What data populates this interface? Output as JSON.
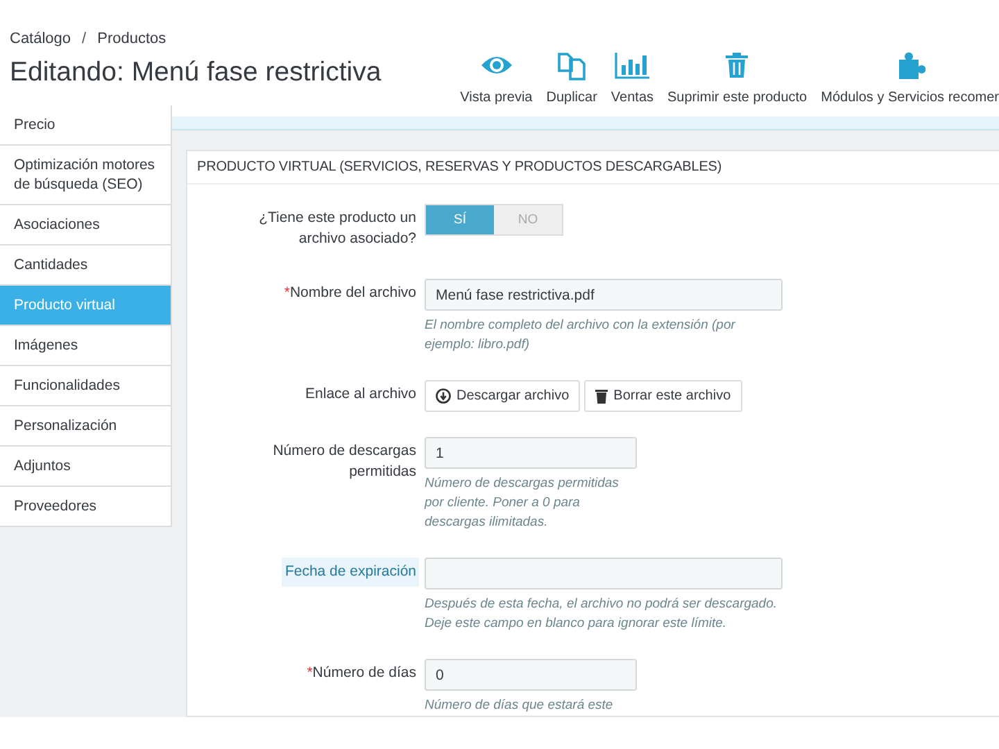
{
  "breadcrumb": {
    "separator": "/",
    "items": [
      "Catálogo",
      "Productos"
    ]
  },
  "title": "Editando: Menú fase restrictiva",
  "toolbar": [
    {
      "label": "Vista previa",
      "kind": "preview"
    },
    {
      "label": "Duplicar",
      "kind": "duplicate"
    },
    {
      "label": "Ventas",
      "kind": "sales"
    },
    {
      "label": "Suprimir este producto",
      "kind": "delete"
    },
    {
      "label": "Módulos y Servicios recomer",
      "kind": "modules"
    }
  ],
  "sidebar": {
    "items": [
      {
        "label": "Precio",
        "selected": false
      },
      {
        "label": "Optimización motores de búsqueda (SEO)",
        "selected": false
      },
      {
        "label": "Asociaciones",
        "selected": false
      },
      {
        "label": "Cantidades",
        "selected": false
      },
      {
        "label": "Producto virtual",
        "selected": true
      },
      {
        "label": "Imágenes",
        "selected": false
      },
      {
        "label": "Funcionalidades",
        "selected": false
      },
      {
        "label": "Personalización",
        "selected": false
      },
      {
        "label": "Adjuntos",
        "selected": false
      },
      {
        "label": "Proveedores",
        "selected": false
      }
    ]
  },
  "panel": {
    "title": "PRODUCTO VIRTUAL (SERVICIOS, RESERVAS Y PRODUCTOS DESCARGABLES)",
    "fields": [
      {
        "kind": "toggle",
        "label": "¿Tiene este producto un archivo asociado?",
        "highlighted": false,
        "options": [
          {
            "label": "SÍ",
            "selected": true
          },
          {
            "label": "NO",
            "selected": false
          }
        ]
      },
      {
        "kind": "text",
        "required_mark": "*",
        "label": "Nombre del archivo",
        "highlighted": false,
        "value": "Menú fase restrictiva.pdf",
        "help": "El nombre completo del archivo con la extensión (por ejemplo: libro.pdf)"
      },
      {
        "kind": "buttons",
        "label": "Enlace al archivo",
        "highlighted": false,
        "buttons": [
          {
            "label": "Descargar archivo",
            "kind": "download"
          },
          {
            "label": "Borrar este archivo",
            "kind": "delete"
          }
        ]
      },
      {
        "kind": "number",
        "label": "Número de descargas permitidas",
        "highlighted": false,
        "value": "1",
        "help": "Número de descargas permitidas por cliente. Poner a 0 para descargas ilimitadas."
      },
      {
        "kind": "date",
        "label": "Fecha de expiración",
        "highlighted": true,
        "help": "Después de esta fecha, el archivo no podrá ser descargado. Deje este campo en blanco para ignorar este límite."
      },
      {
        "kind": "number",
        "required_mark": "*",
        "label": "Número de días",
        "highlighted": false,
        "value": "0",
        "help": "Número de días que estará este"
      }
    ]
  }
}
